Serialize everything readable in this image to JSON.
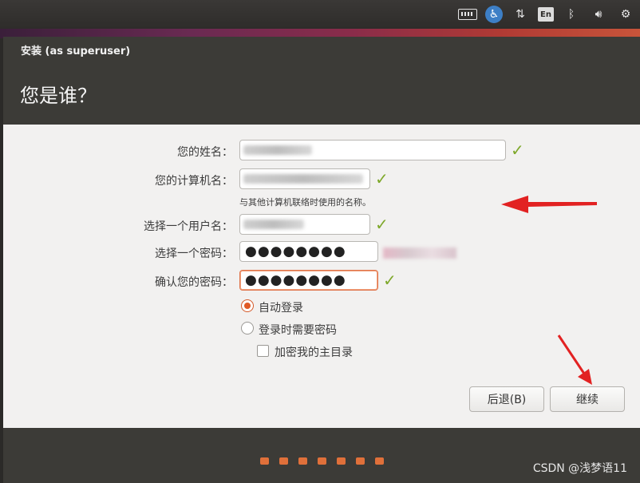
{
  "tray": {
    "icons": [
      "keyboard-icon",
      "accessibility-icon",
      "network-icon",
      "input-method-icon",
      "bluetooth-icon",
      "volume-icon",
      "settings-icon"
    ],
    "input_method_label": "En"
  },
  "window": {
    "title": "安装 (as superuser)",
    "heading": "您是谁？"
  },
  "form": {
    "name_label": "您的姓名：",
    "computer_label": "您的计算机名：",
    "computer_hint": "与其他计算机联络时使用的名称。",
    "username_label": "选择一个用户名：",
    "password_label": "选择一个密码：",
    "confirm_label": "确认您的密码：",
    "password_value": "●●●●●●●●",
    "confirm_value": "●●●●●●●●",
    "checkmark": "✓"
  },
  "options": {
    "auto_login": "自动登录",
    "require_password": "登录时需要密码",
    "encrypt_home": "加密我的主目录",
    "selected": "auto_login"
  },
  "buttons": {
    "back": "后退(B)",
    "continue": "继续"
  },
  "progress": {
    "total_steps": 7
  },
  "watermark": "CSDN @浅梦语11",
  "colors": {
    "accent": "#e05a26",
    "check": "#7ea82a",
    "annotation": "#e22222"
  }
}
